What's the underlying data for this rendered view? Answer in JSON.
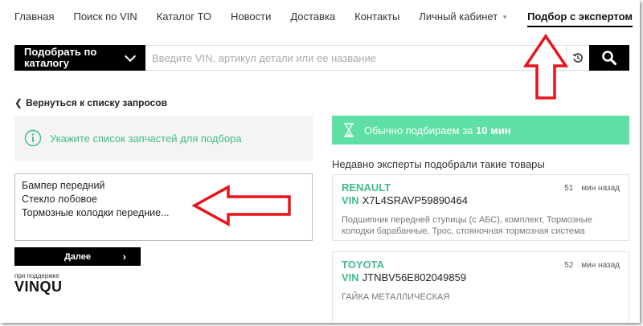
{
  "nav": {
    "items": [
      {
        "label": "Главная"
      },
      {
        "label": "Поиск по VIN"
      },
      {
        "label": "Каталог ТО"
      },
      {
        "label": "Новости"
      },
      {
        "label": "Доставка"
      },
      {
        "label": "Контакты"
      },
      {
        "label": "Личный кабинет"
      },
      {
        "label": "Подбор с экспертом"
      }
    ]
  },
  "search": {
    "catalog_label": "Подобрать по каталогу",
    "placeholder": "Введите VIN, артикул детали или ее название"
  },
  "back_link": "Вернуться к списку запросов",
  "info": {
    "text": "Укажите список запчастей для подбора"
  },
  "request": {
    "value": "Бампер передний\nСтекло лобовое\nТормозные колодки передние..."
  },
  "next_label": "Далее",
  "powered": {
    "caption": "при поддержке",
    "logo": "VINQU"
  },
  "eta": {
    "prefix": "Обычно подбираем за",
    "value": "10 мин"
  },
  "recent": {
    "heading": "Недавно эксперты подобрали такие товары",
    "vin_label": "VIN",
    "cards": [
      {
        "brand": "RENAULT",
        "vin": "X7L4SRAVP59890464",
        "minutes": "51",
        "time_suffix": "мин назад",
        "desc": "Подшипник передней ступицы (с АБС), комплект, Тормозные колодки барабанные, Трос, стояночная тормозная система"
      },
      {
        "brand": "TOYOTA",
        "vin": "JTNBV56E802049859",
        "minutes": "52",
        "time_suffix": "мин назад",
        "desc": "ГАЙКА МЕТАЛЛИЧЕСКАЯ"
      }
    ]
  },
  "colors": {
    "accent_green": "#3fbf87",
    "eta_bg": "#5ee0a4",
    "annotation_red": "#e8141d"
  },
  "icons": {
    "info": "info-circle-icon",
    "hourglass": "hourglass-icon",
    "history": "history-icon",
    "search": "search-icon"
  }
}
